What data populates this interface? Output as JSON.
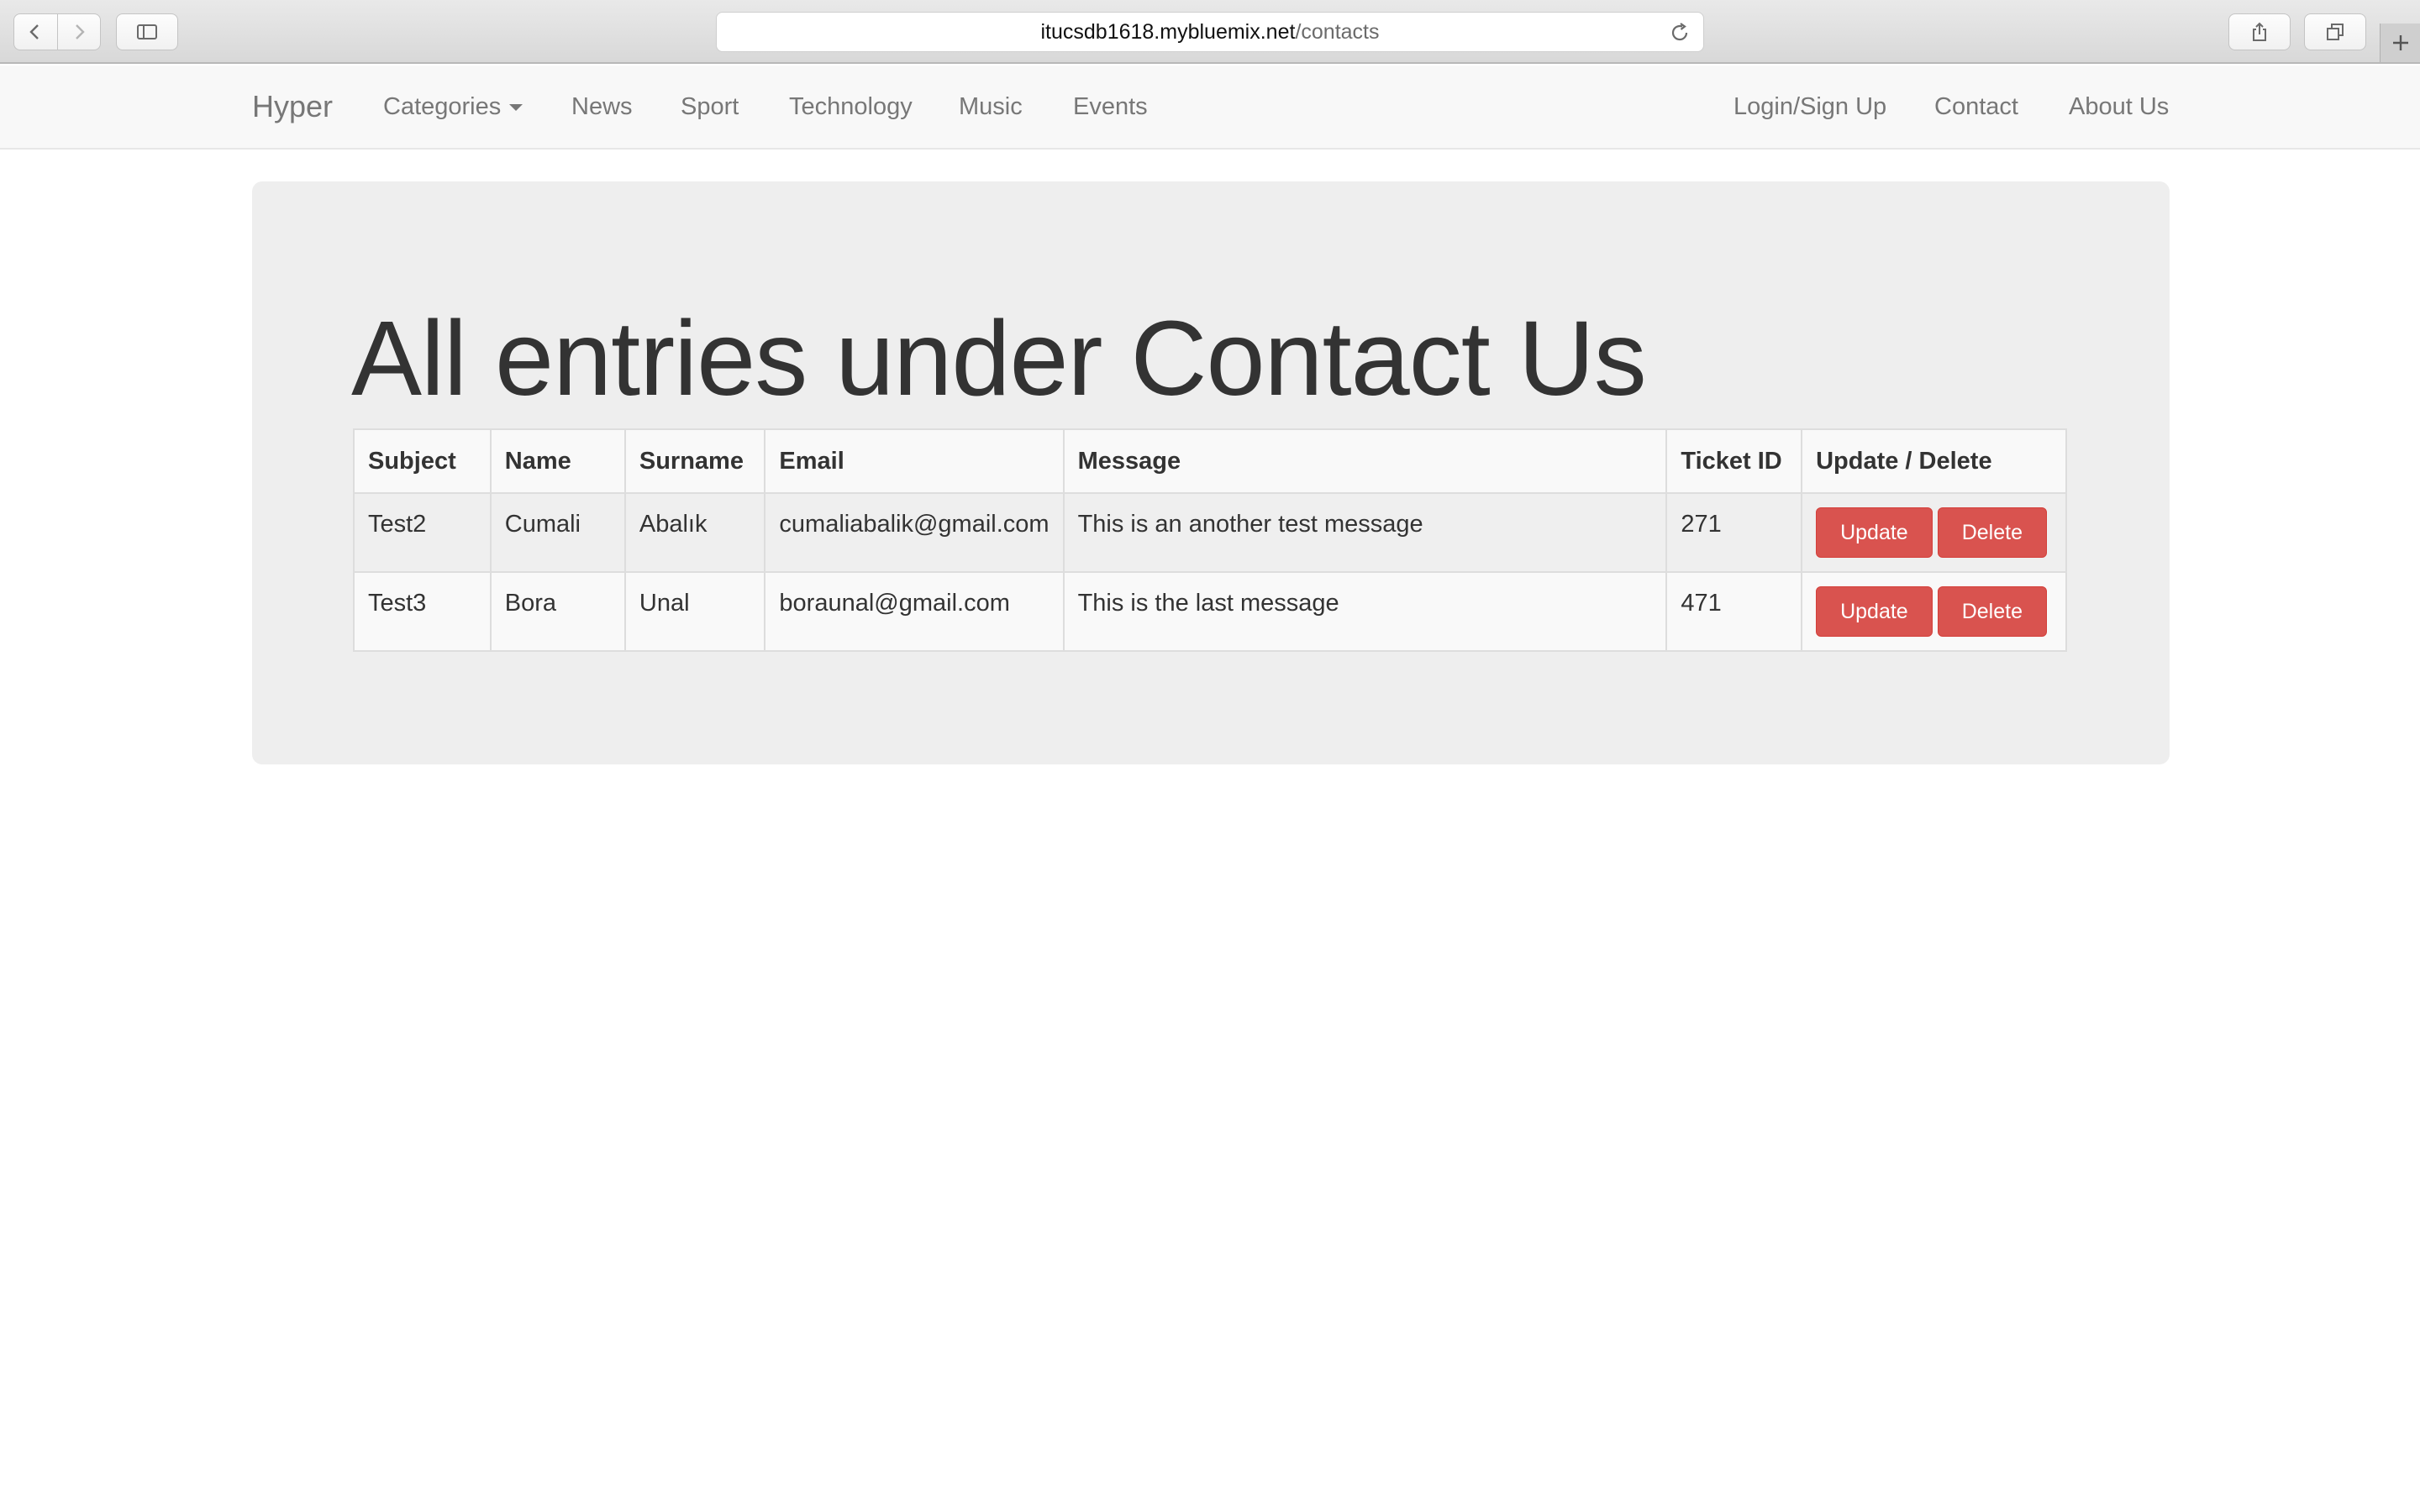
{
  "browser": {
    "url_host": "itucsdb1618.mybluemix.net",
    "url_path": "/contacts",
    "icons": {
      "back": "chevron-left-icon",
      "forward": "chevron-right-icon",
      "sidebar": "sidebar-icon",
      "reload": "reload-icon",
      "share": "share-icon",
      "tabs": "tabs-icon",
      "new_tab": "plus-icon"
    }
  },
  "navbar": {
    "brand": "Hyper",
    "left_links": {
      "categories": "Categories",
      "news": "News",
      "sport": "Sport",
      "technology": "Technology",
      "music": "Music",
      "events": "Events"
    },
    "right_links": {
      "login": "Login/Sign Up",
      "contact": "Contact",
      "about": "About Us"
    }
  },
  "main": {
    "title": "All entries under Contact Us",
    "table": {
      "columns": [
        "Subject",
        "Name",
        "Surname",
        "Email",
        "Message",
        "Ticket ID",
        "Update / Delete"
      ],
      "rows": [
        {
          "subject": "Test2",
          "name": "Cumali",
          "surname": "Abalık",
          "email": "cumaliabalik@gmail.com",
          "message": "This is an another test message",
          "ticket_id": "271",
          "update_label": "Update",
          "delete_label": "Delete"
        },
        {
          "subject": "Test3",
          "name": "Bora",
          "surname": "Unal",
          "email": "boraunal@gmail.com",
          "message": "This is the last message",
          "ticket_id": "471",
          "update_label": "Update",
          "delete_label": "Delete"
        }
      ]
    }
  },
  "colors": {
    "navbar_bg": "#f8f8f8",
    "jumbotron_bg": "#eeeeee",
    "danger": "#d9534f",
    "nav_text": "#777777"
  }
}
